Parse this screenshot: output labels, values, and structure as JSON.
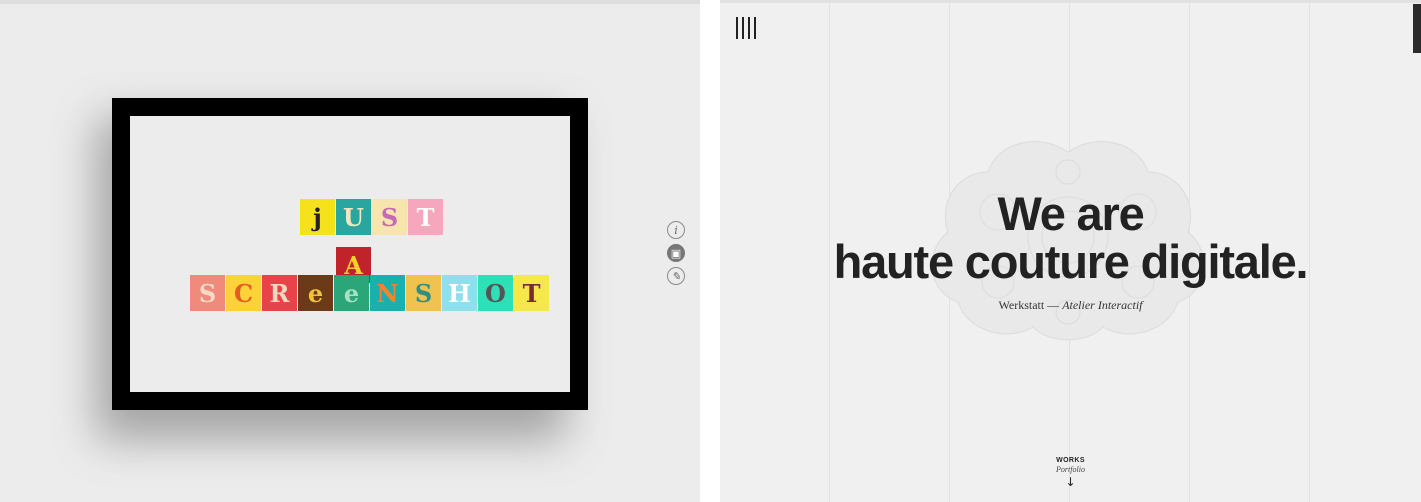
{
  "left_panel": {
    "art_lines": [
      [
        {
          "ch": "j",
          "bg": "#f6e21c",
          "fg": "#222222"
        },
        {
          "ch": "U",
          "bg": "#2aa6a0",
          "fg": "#f2e6c0"
        },
        {
          "ch": "S",
          "bg": "#f7e5ad",
          "fg": "#c468b7"
        },
        {
          "ch": "T",
          "bg": "#f6a6bd",
          "fg": "#ffffff"
        }
      ],
      [
        {
          "ch": "A",
          "bg": "#c1232a",
          "fg": "#f3d12a"
        }
      ],
      [
        {
          "ch": "S",
          "bg": "#f08a7a",
          "fg": "#f6d9c8"
        },
        {
          "ch": "C",
          "bg": "#ffd23a",
          "fg": "#e35d20"
        },
        {
          "ch": "R",
          "bg": "#e8424a",
          "fg": "#f3d7c0"
        },
        {
          "ch": "e",
          "bg": "#6b3a17",
          "fg": "#f2c23b"
        },
        {
          "ch": "e",
          "bg": "#2aa678",
          "fg": "#a8e0c4"
        },
        {
          "ch": "N",
          "bg": "#1ab0ae",
          "fg": "#f1842e"
        },
        {
          "ch": "S",
          "bg": "#f0c24e",
          "fg": "#2f8f86"
        },
        {
          "ch": "H",
          "bg": "#8fe0ef",
          "fg": "#ffffff"
        },
        {
          "ch": "O",
          "bg": "#2ee0b8",
          "fg": "#555555"
        },
        {
          "ch": "T",
          "bg": "#f5e84a",
          "fg": "#7a2a30"
        }
      ]
    ],
    "side_icons": [
      {
        "glyph": "i",
        "name": "info-icon"
      },
      {
        "glyph": "▣",
        "name": "document-icon"
      },
      {
        "glyph": "✎",
        "name": "link-icon"
      }
    ]
  },
  "right_panel": {
    "headline_line1": "We are",
    "headline_line2": "haute couture digitale.",
    "subline_plain": "Werkstatt — ",
    "subline_italic": "Atelier Interactif",
    "works_label": "WORKS",
    "works_sub": "Portfolio",
    "works_arrow": "↓"
  }
}
